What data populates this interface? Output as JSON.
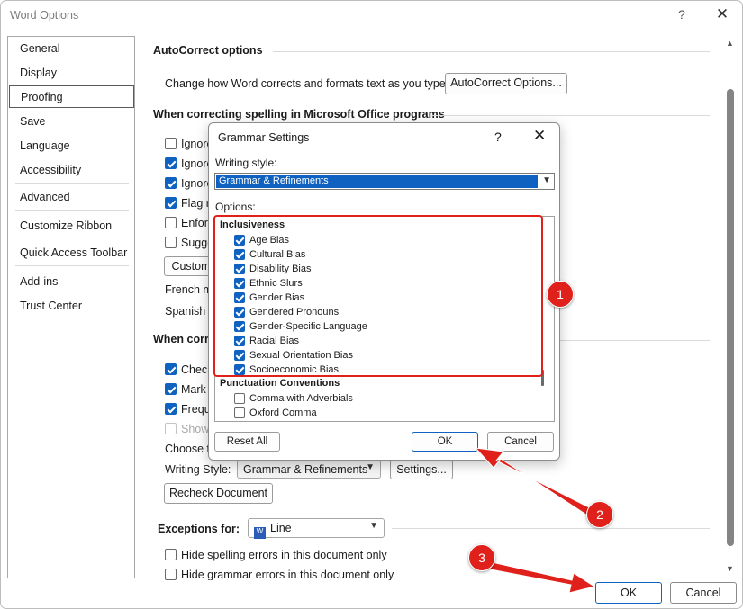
{
  "window": {
    "title": "Word Options",
    "help": "?",
    "close": "✕"
  },
  "nav": {
    "items": [
      "General",
      "Display",
      "Proofing",
      "Save",
      "Language",
      "Accessibility",
      "Advanced",
      "Customize Ribbon",
      "Quick Access Toolbar",
      "Add-ins",
      "Trust Center"
    ],
    "selected": "Proofing"
  },
  "autocorrect": {
    "title": "AutoCorrect options",
    "desc": "Change how Word corrects and formats text as you type:",
    "button": "AutoCorrect Options..."
  },
  "spelling_office": {
    "title": "When correcting spelling in Microsoft Office programs",
    "items": [
      {
        "label": "Ignore",
        "checked": false
      },
      {
        "label": "Ignore",
        "checked": true
      },
      {
        "label": "Ignore",
        "checked": true
      },
      {
        "label": "Flag re",
        "checked": true
      },
      {
        "label": "Enforc",
        "checked": false
      },
      {
        "label": "Sugge",
        "checked": false
      }
    ],
    "custom_button": "Custom",
    "french": "French m",
    "spanish": "Spanish m"
  },
  "spelling_word": {
    "title": "When corre",
    "items": [
      {
        "label": "Check",
        "checked": true
      },
      {
        "label": "Mark g",
        "checked": true
      },
      {
        "label": "Frequ",
        "checked": true
      },
      {
        "label": "Show",
        "checked": false,
        "disabled": true
      }
    ],
    "choose_label": "Choose th",
    "writing_style_label": "Writing Style:",
    "writing_style_value": "Grammar & Refinements",
    "settings_button": "Settings...",
    "recheck_button": "Recheck Document"
  },
  "exceptions": {
    "label": "Exceptions for:",
    "doc_value": "Line",
    "hide_spelling": "Hide spelling errors in this document only",
    "hide_grammar": "Hide grammar errors in this document only"
  },
  "footer": {
    "ok": "OK",
    "cancel": "Cancel"
  },
  "grammar_dialog": {
    "title": "Grammar Settings",
    "help": "?",
    "close": "✕",
    "writing_style_label": "Writing style:",
    "writing_style_value": "Grammar & Refinements",
    "options_label": "Options:",
    "groups": [
      {
        "name": "Inclusiveness",
        "items": [
          {
            "label": "Age Bias",
            "checked": true
          },
          {
            "label": "Cultural Bias",
            "checked": true
          },
          {
            "label": "Disability Bias",
            "checked": true
          },
          {
            "label": "Ethnic Slurs",
            "checked": true
          },
          {
            "label": "Gender Bias",
            "checked": true
          },
          {
            "label": "Gendered Pronouns",
            "checked": true
          },
          {
            "label": "Gender-Specific Language",
            "checked": true
          },
          {
            "label": "Racial Bias",
            "checked": true
          },
          {
            "label": "Sexual Orientation Bias",
            "checked": true
          },
          {
            "label": "Socioeconomic Bias",
            "checked": true
          }
        ]
      },
      {
        "name": "Punctuation Conventions",
        "items": [
          {
            "label": "Comma with Adverbials",
            "checked": false
          },
          {
            "label": "Oxford Comma",
            "checked": false
          }
        ]
      }
    ],
    "reset_button": "Reset All",
    "ok_button": "OK",
    "cancel_button": "Cancel"
  },
  "annotations": {
    "badges": [
      "1",
      "2",
      "3"
    ],
    "color": "#e0201a"
  },
  "colors": {
    "accent": "#0f62bf",
    "annotation": "#e0201a"
  }
}
